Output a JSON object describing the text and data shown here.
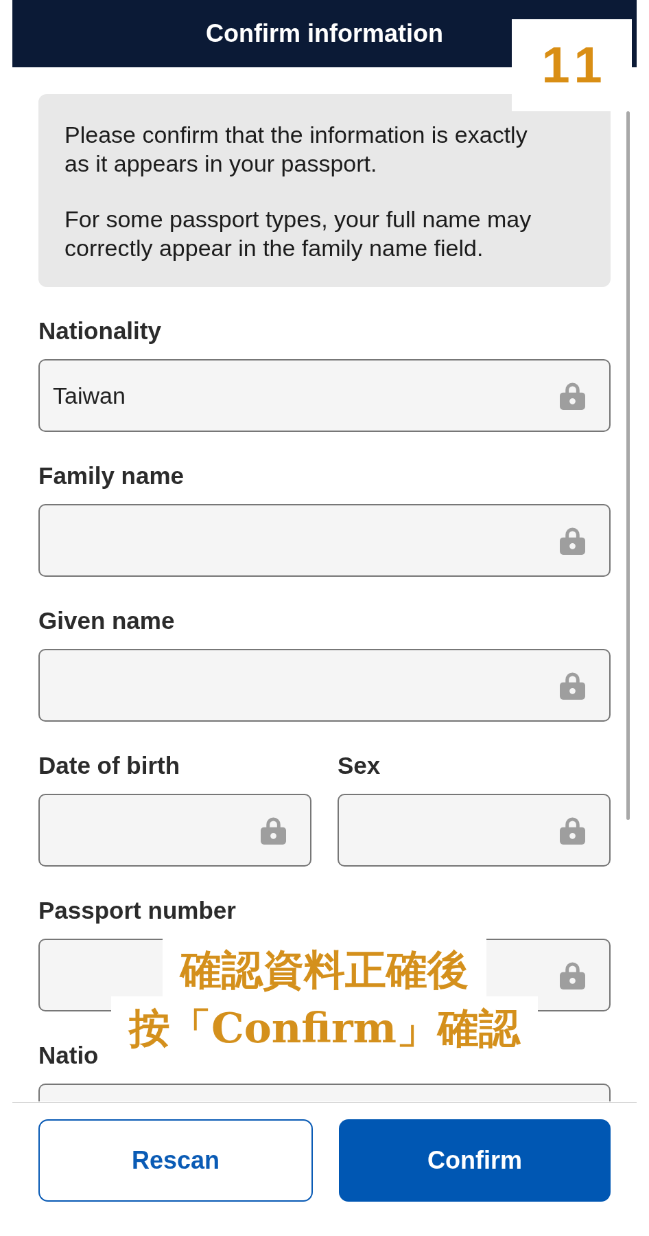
{
  "header": {
    "title": "Confirm information"
  },
  "step_badge": {
    "label": "11"
  },
  "notice": {
    "paragraphs": [
      "Please confirm that the information is exactly as it appears in your passport.",
      "For some passport types, your full name may correctly appear in the family name field."
    ]
  },
  "form": {
    "rows": [
      [
        {
          "label": "Nationality",
          "value": "Taiwan",
          "locked": true
        }
      ],
      [
        {
          "label": "Family name",
          "locked": true
        }
      ],
      [
        {
          "label": "Given name",
          "locked": true
        }
      ],
      [
        {
          "label": "Date of birth",
          "locked": true
        },
        {
          "label": "Sex",
          "locked": true
        }
      ],
      [
        {
          "label": "Passport number",
          "locked": true
        }
      ],
      [
        {
          "label": "Natio"
        }
      ]
    ]
  },
  "caption": {
    "lines": [
      "確認資料正確後",
      "按「Confirm」確認"
    ]
  },
  "buttons": [
    {
      "label": "Rescan",
      "kind": "secondary"
    },
    {
      "label": "Confirm",
      "kind": "primary"
    }
  ]
}
